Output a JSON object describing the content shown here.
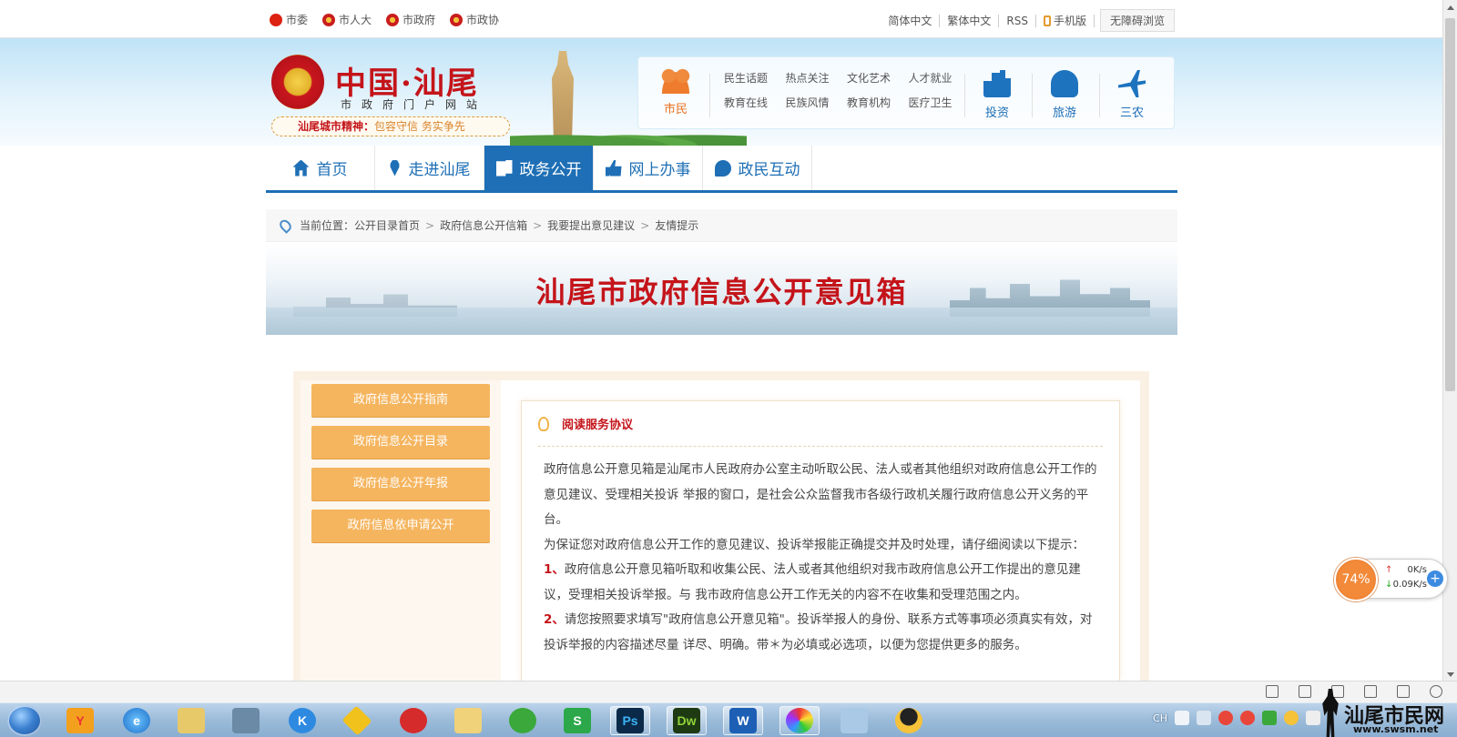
{
  "top_links": {
    "left": [
      {
        "label": "市委",
        "icon": "party-icon"
      },
      {
        "label": "市人大",
        "icon": "emblem-icon"
      },
      {
        "label": "市政府",
        "icon": "emblem-icon"
      },
      {
        "label": "市政协",
        "icon": "cppcc-icon"
      }
    ],
    "right": [
      "简体中文",
      "繁体中文",
      "RSS",
      "手机版"
    ],
    "accessibility": "无障碍浏览"
  },
  "header": {
    "site_name": "中国·汕尾",
    "site_sub": "市政府门户网站",
    "spirit_label": "汕尾城市精神：",
    "spirit_value": "包容守信  务实争先"
  },
  "quick_nav": {
    "main": "市民",
    "links": [
      "民生话题",
      "热点关注",
      "文化艺术",
      "人才就业",
      "教育在线",
      "民族风情",
      "教育机构",
      "医疗卫生"
    ],
    "categories": [
      "投资",
      "旅游",
      "三农"
    ]
  },
  "main_nav": [
    {
      "label": "首页",
      "icon": "home-icon",
      "active": false
    },
    {
      "label": "走进汕尾",
      "icon": "location-pin-icon",
      "active": false
    },
    {
      "label": "政务公开",
      "icon": "document-icon",
      "active": true
    },
    {
      "label": "网上办事",
      "icon": "thumbs-up-icon",
      "active": false
    },
    {
      "label": "政民互动",
      "icon": "chat-bubble-icon",
      "active": false
    }
  ],
  "breadcrumb": {
    "prefix": "当前位置：",
    "items": [
      "公开目录首页",
      "政府信息公开信箱",
      "我要提出意见建议",
      "友情提示"
    ]
  },
  "page_title": "汕尾市政府信息公开意见箱",
  "sidebar": [
    "政府信息公开指南",
    "政府信息公开目录",
    "政府信息公开年报",
    "政府信息依申请公开"
  ],
  "agreement": {
    "title": "阅读服务协议",
    "intro": "政府信息公开意见箱是汕尾市人民政府办公室主动听取公民、法人或者其他组织对政府信息公开工作的意见建议、受理相关投诉 举报的窗口，是社会公众监督我市各级行政机关履行政府信息公开义务的平台。",
    "notice": "为保证您对政府信息公开工作的意见建议、投诉举报能正确提交并及时处理，请仔细阅读以下提示：",
    "item1_num": "1、",
    "item1": "政府信息公开意见箱听取和收集公民、法人或者其他组织对我市政府信息公开工作提出的意见建议，受理相关投诉举报。与 我市政府信息公开工作无关的内容不在收集和受理范围之内。",
    "item2_num": "2、",
    "item2": "请您按照要求填写\"政府信息公开意见箱\"。投诉举报人的身份、联系方式等事项必须真实有效，对投诉举报的内容描述尽量 详尽、明确。带＊为必填或必选项，以便为您提供更多的服务。"
  },
  "net_widget": {
    "percent": "74%",
    "up": "0K/s",
    "down": "0.09K/s"
  },
  "taskbar": {
    "lang": "CH",
    "apps": [
      "explorer-icon",
      "ie-icon",
      "app-icon",
      "app-icon",
      "kugou-icon",
      "ie-tester-icon",
      "app-icon",
      "folder-icon",
      "refresh-icon",
      "s-icon",
      "photoshop-icon",
      "dreamweaver-icon",
      "word-icon",
      "picasa-icon",
      "notepad-icon",
      "qq-icon"
    ],
    "app_labels": {
      "ps": "Ps",
      "dw": "Dw",
      "w": "W",
      "s": "S",
      "k": "K"
    }
  },
  "watermark": {
    "title": "汕尾市民网",
    "url": "www.swsm.net"
  },
  "colors": {
    "brand_blue": "#1e6fb5",
    "red": "#c4141a",
    "orange": "#f5b55f"
  }
}
